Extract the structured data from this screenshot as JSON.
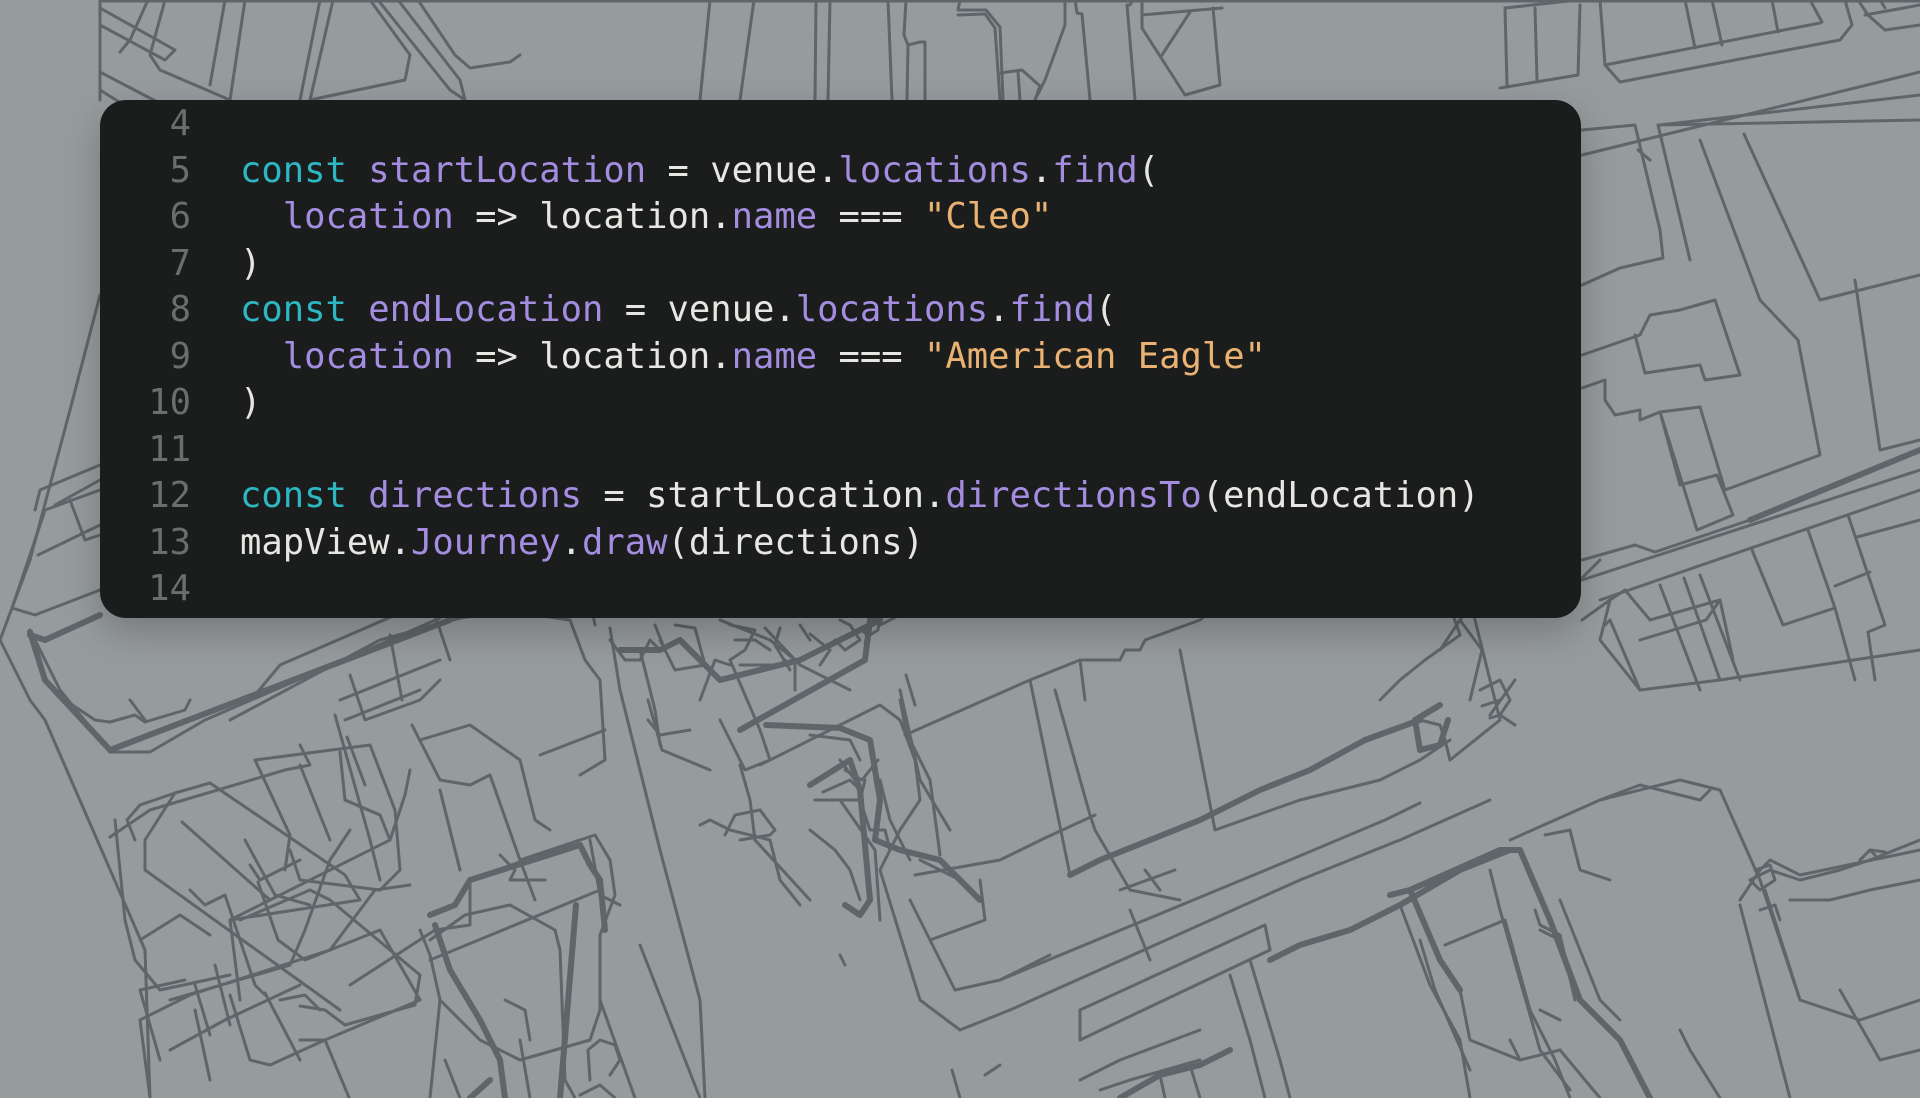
{
  "theme": {
    "panel_background": "#1b1c1c",
    "map_background": "#969b9e",
    "map_lines": "#5f6568",
    "line_number_color": "#6b6e6f",
    "keyword_color": "#2cb7c3",
    "identifier_color": "#a48de0",
    "string_color": "#e9b272",
    "text_color": "#e6e6e3"
  },
  "background": {
    "type": "map-illustration",
    "icon": "venue-floor-plan"
  },
  "code": {
    "language": "javascript",
    "lines": [
      {
        "number": "4",
        "tokens": []
      },
      {
        "number": "5",
        "tokens": [
          {
            "t": "const",
            "k": "kw"
          },
          {
            "t": " ",
            "k": "plain"
          },
          {
            "t": "startLocation",
            "k": "var"
          },
          {
            "t": " = venue.",
            "k": "plain"
          },
          {
            "t": "locations",
            "k": "prop"
          },
          {
            "t": ".",
            "k": "plain"
          },
          {
            "t": "find",
            "k": "prop"
          },
          {
            "t": "(",
            "k": "plain"
          }
        ]
      },
      {
        "number": "6",
        "tokens": [
          {
            "t": "  ",
            "k": "plain"
          },
          {
            "t": "location",
            "k": "var"
          },
          {
            "t": " => location.",
            "k": "plain"
          },
          {
            "t": "name",
            "k": "prop"
          },
          {
            "t": " === ",
            "k": "plain"
          },
          {
            "t": "\"Cleo\"",
            "k": "str"
          }
        ]
      },
      {
        "number": "7",
        "tokens": [
          {
            "t": ")",
            "k": "plain"
          }
        ]
      },
      {
        "number": "8",
        "tokens": [
          {
            "t": "const",
            "k": "kw"
          },
          {
            "t": " ",
            "k": "plain"
          },
          {
            "t": "endLocation",
            "k": "var"
          },
          {
            "t": " = venue.",
            "k": "plain"
          },
          {
            "t": "locations",
            "k": "prop"
          },
          {
            "t": ".",
            "k": "plain"
          },
          {
            "t": "find",
            "k": "prop"
          },
          {
            "t": "(",
            "k": "plain"
          }
        ]
      },
      {
        "number": "9",
        "tokens": [
          {
            "t": "  ",
            "k": "plain"
          },
          {
            "t": "location",
            "k": "var"
          },
          {
            "t": " => location.",
            "k": "plain"
          },
          {
            "t": "name",
            "k": "prop"
          },
          {
            "t": " === ",
            "k": "plain"
          },
          {
            "t": "\"American Eagle\"",
            "k": "str"
          }
        ]
      },
      {
        "number": "10",
        "tokens": [
          {
            "t": ")",
            "k": "plain"
          }
        ]
      },
      {
        "number": "11",
        "tokens": []
      },
      {
        "number": "12",
        "tokens": [
          {
            "t": "const",
            "k": "kw"
          },
          {
            "t": " ",
            "k": "plain"
          },
          {
            "t": "directions",
            "k": "var"
          },
          {
            "t": " = startLocation.",
            "k": "plain"
          },
          {
            "t": "directionsTo",
            "k": "prop"
          },
          {
            "t": "(endLocation)",
            "k": "plain"
          }
        ]
      },
      {
        "number": "13",
        "tokens": [
          {
            "t": "mapView.",
            "k": "plain"
          },
          {
            "t": "Journey",
            "k": "prop"
          },
          {
            "t": ".",
            "k": "plain"
          },
          {
            "t": "draw",
            "k": "prop"
          },
          {
            "t": "(directions)",
            "k": "plain"
          }
        ]
      },
      {
        "number": "14",
        "tokens": []
      }
    ]
  }
}
